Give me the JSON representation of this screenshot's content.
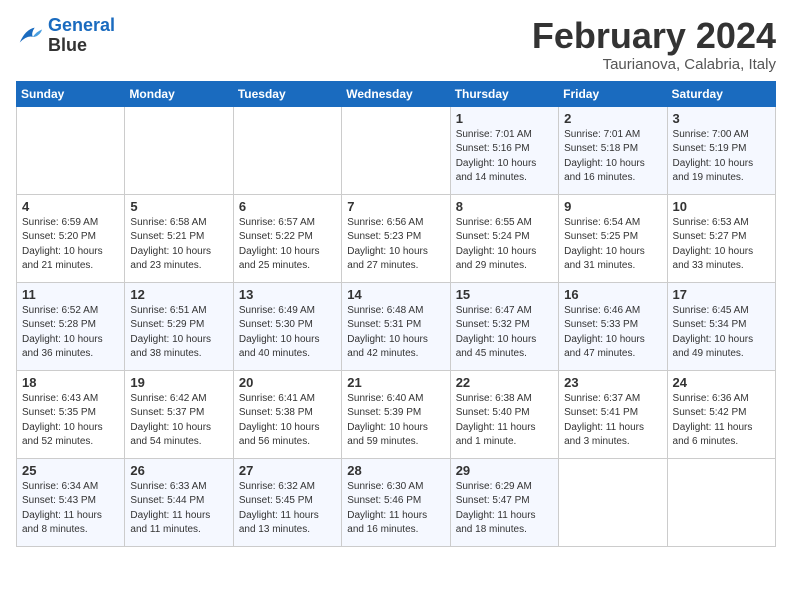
{
  "logo": {
    "line1": "General",
    "line2": "Blue"
  },
  "title": "February 2024",
  "subtitle": "Taurianova, Calabria, Italy",
  "weekdays": [
    "Sunday",
    "Monday",
    "Tuesday",
    "Wednesday",
    "Thursday",
    "Friday",
    "Saturday"
  ],
  "weeks": [
    [
      {
        "day": "",
        "info": ""
      },
      {
        "day": "",
        "info": ""
      },
      {
        "day": "",
        "info": ""
      },
      {
        "day": "",
        "info": ""
      },
      {
        "day": "1",
        "info": "Sunrise: 7:01 AM\nSunset: 5:16 PM\nDaylight: 10 hours\nand 14 minutes."
      },
      {
        "day": "2",
        "info": "Sunrise: 7:01 AM\nSunset: 5:18 PM\nDaylight: 10 hours\nand 16 minutes."
      },
      {
        "day": "3",
        "info": "Sunrise: 7:00 AM\nSunset: 5:19 PM\nDaylight: 10 hours\nand 19 minutes."
      }
    ],
    [
      {
        "day": "4",
        "info": "Sunrise: 6:59 AM\nSunset: 5:20 PM\nDaylight: 10 hours\nand 21 minutes."
      },
      {
        "day": "5",
        "info": "Sunrise: 6:58 AM\nSunset: 5:21 PM\nDaylight: 10 hours\nand 23 minutes."
      },
      {
        "day": "6",
        "info": "Sunrise: 6:57 AM\nSunset: 5:22 PM\nDaylight: 10 hours\nand 25 minutes."
      },
      {
        "day": "7",
        "info": "Sunrise: 6:56 AM\nSunset: 5:23 PM\nDaylight: 10 hours\nand 27 minutes."
      },
      {
        "day": "8",
        "info": "Sunrise: 6:55 AM\nSunset: 5:24 PM\nDaylight: 10 hours\nand 29 minutes."
      },
      {
        "day": "9",
        "info": "Sunrise: 6:54 AM\nSunset: 5:25 PM\nDaylight: 10 hours\nand 31 minutes."
      },
      {
        "day": "10",
        "info": "Sunrise: 6:53 AM\nSunset: 5:27 PM\nDaylight: 10 hours\nand 33 minutes."
      }
    ],
    [
      {
        "day": "11",
        "info": "Sunrise: 6:52 AM\nSunset: 5:28 PM\nDaylight: 10 hours\nand 36 minutes."
      },
      {
        "day": "12",
        "info": "Sunrise: 6:51 AM\nSunset: 5:29 PM\nDaylight: 10 hours\nand 38 minutes."
      },
      {
        "day": "13",
        "info": "Sunrise: 6:49 AM\nSunset: 5:30 PM\nDaylight: 10 hours\nand 40 minutes."
      },
      {
        "day": "14",
        "info": "Sunrise: 6:48 AM\nSunset: 5:31 PM\nDaylight: 10 hours\nand 42 minutes."
      },
      {
        "day": "15",
        "info": "Sunrise: 6:47 AM\nSunset: 5:32 PM\nDaylight: 10 hours\nand 45 minutes."
      },
      {
        "day": "16",
        "info": "Sunrise: 6:46 AM\nSunset: 5:33 PM\nDaylight: 10 hours\nand 47 minutes."
      },
      {
        "day": "17",
        "info": "Sunrise: 6:45 AM\nSunset: 5:34 PM\nDaylight: 10 hours\nand 49 minutes."
      }
    ],
    [
      {
        "day": "18",
        "info": "Sunrise: 6:43 AM\nSunset: 5:35 PM\nDaylight: 10 hours\nand 52 minutes."
      },
      {
        "day": "19",
        "info": "Sunrise: 6:42 AM\nSunset: 5:37 PM\nDaylight: 10 hours\nand 54 minutes."
      },
      {
        "day": "20",
        "info": "Sunrise: 6:41 AM\nSunset: 5:38 PM\nDaylight: 10 hours\nand 56 minutes."
      },
      {
        "day": "21",
        "info": "Sunrise: 6:40 AM\nSunset: 5:39 PM\nDaylight: 10 hours\nand 59 minutes."
      },
      {
        "day": "22",
        "info": "Sunrise: 6:38 AM\nSunset: 5:40 PM\nDaylight: 11 hours\nand 1 minute."
      },
      {
        "day": "23",
        "info": "Sunrise: 6:37 AM\nSunset: 5:41 PM\nDaylight: 11 hours\nand 3 minutes."
      },
      {
        "day": "24",
        "info": "Sunrise: 6:36 AM\nSunset: 5:42 PM\nDaylight: 11 hours\nand 6 minutes."
      }
    ],
    [
      {
        "day": "25",
        "info": "Sunrise: 6:34 AM\nSunset: 5:43 PM\nDaylight: 11 hours\nand 8 minutes."
      },
      {
        "day": "26",
        "info": "Sunrise: 6:33 AM\nSunset: 5:44 PM\nDaylight: 11 hours\nand 11 minutes."
      },
      {
        "day": "27",
        "info": "Sunrise: 6:32 AM\nSunset: 5:45 PM\nDaylight: 11 hours\nand 13 minutes."
      },
      {
        "day": "28",
        "info": "Sunrise: 6:30 AM\nSunset: 5:46 PM\nDaylight: 11 hours\nand 16 minutes."
      },
      {
        "day": "29",
        "info": "Sunrise: 6:29 AM\nSunset: 5:47 PM\nDaylight: 11 hours\nand 18 minutes."
      },
      {
        "day": "",
        "info": ""
      },
      {
        "day": "",
        "info": ""
      }
    ]
  ]
}
